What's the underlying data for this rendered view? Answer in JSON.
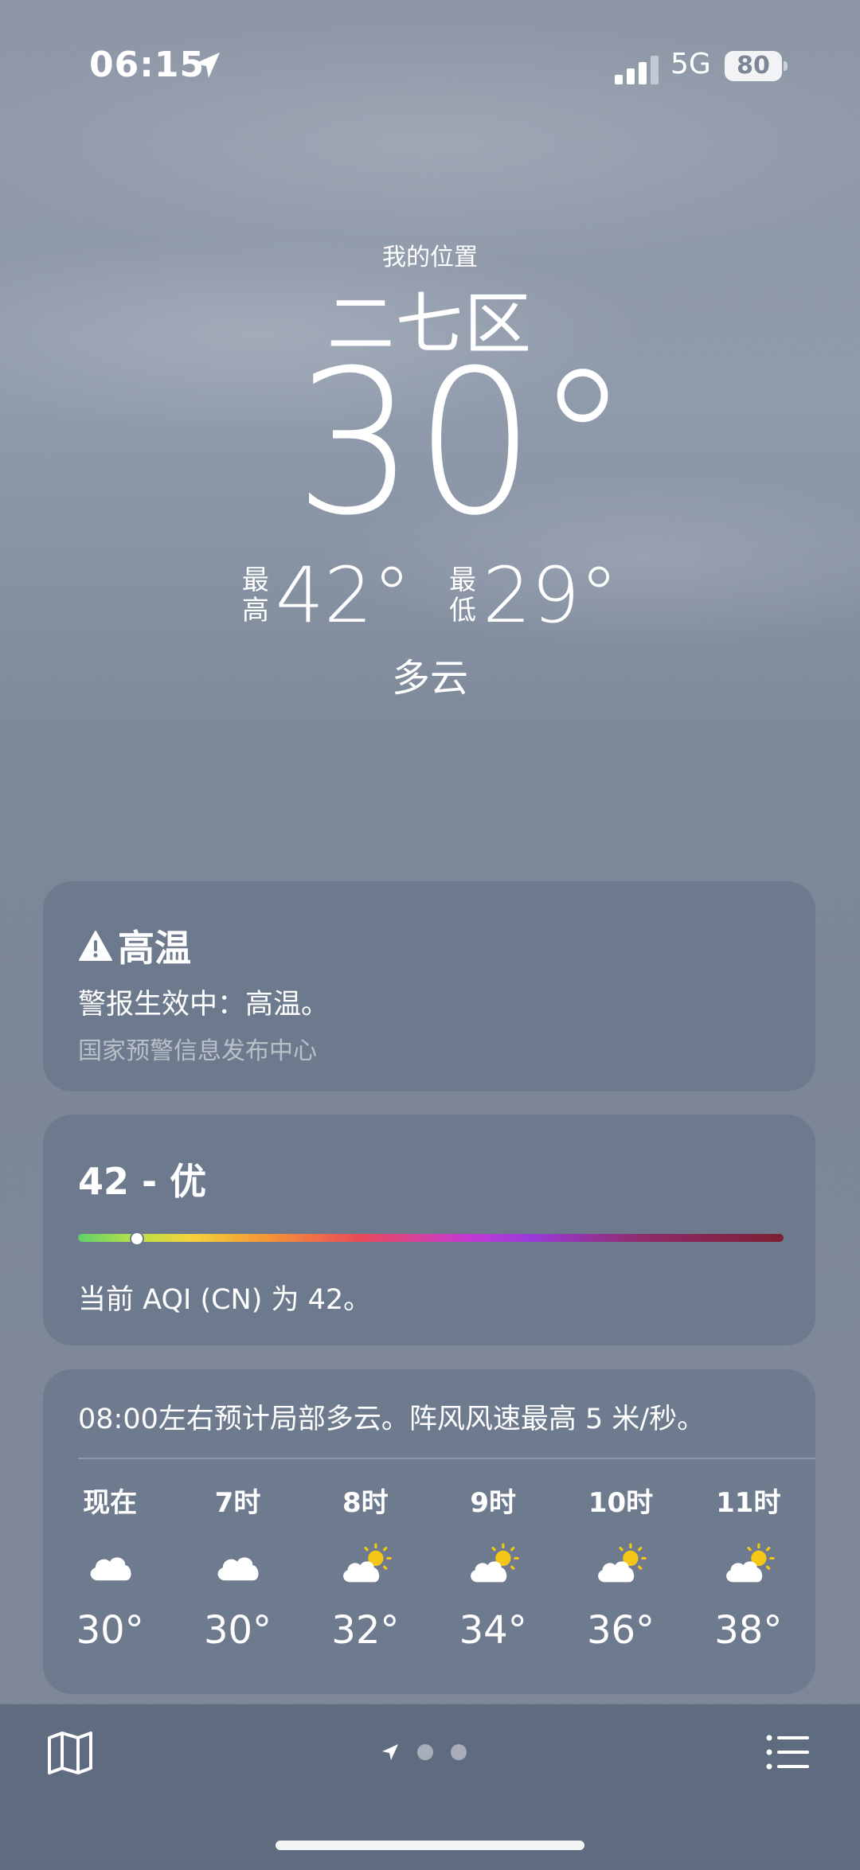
{
  "status_bar": {
    "time": "06:15",
    "network": "5G",
    "battery": "80"
  },
  "hero": {
    "location_label": "我的位置",
    "city": "二七区",
    "temperature": "30°",
    "high_label_1": "最",
    "high_label_2": "高",
    "high": "42°",
    "low_label_1": "最",
    "low_label_2": "低",
    "low": "29°",
    "condition": "多云"
  },
  "alert": {
    "title": "高温",
    "body": "警报生效中：高温。",
    "source": "国家预警信息发布中心"
  },
  "aqi": {
    "title": "42 - 优",
    "value": 42,
    "scale_max": 500,
    "description": "当前 AQI (CN) 为 42。"
  },
  "hourly": {
    "summary": "08:00左右预计局部多云。阵风风速最高 5 米/秒。",
    "items": [
      {
        "label": "现在",
        "icon": "cloud-icon",
        "temp": "30°"
      },
      {
        "label": "7时",
        "icon": "cloud-icon",
        "temp": "30°"
      },
      {
        "label": "8时",
        "icon": "sun-behind-cloud-icon",
        "temp": "32°"
      },
      {
        "label": "9时",
        "icon": "sun-behind-cloud-icon",
        "temp": "34°"
      },
      {
        "label": "10时",
        "icon": "sun-behind-cloud-icon",
        "temp": "36°"
      },
      {
        "label": "11时",
        "icon": "sun-behind-cloud-icon",
        "temp": "38°"
      }
    ]
  },
  "bottom_bar": {
    "page_count": 3,
    "current_page": "current-location"
  },
  "colors": {
    "card_bg": "#647288",
    "sun": "#f5c518",
    "bottom_bar": "#5f6c80"
  }
}
